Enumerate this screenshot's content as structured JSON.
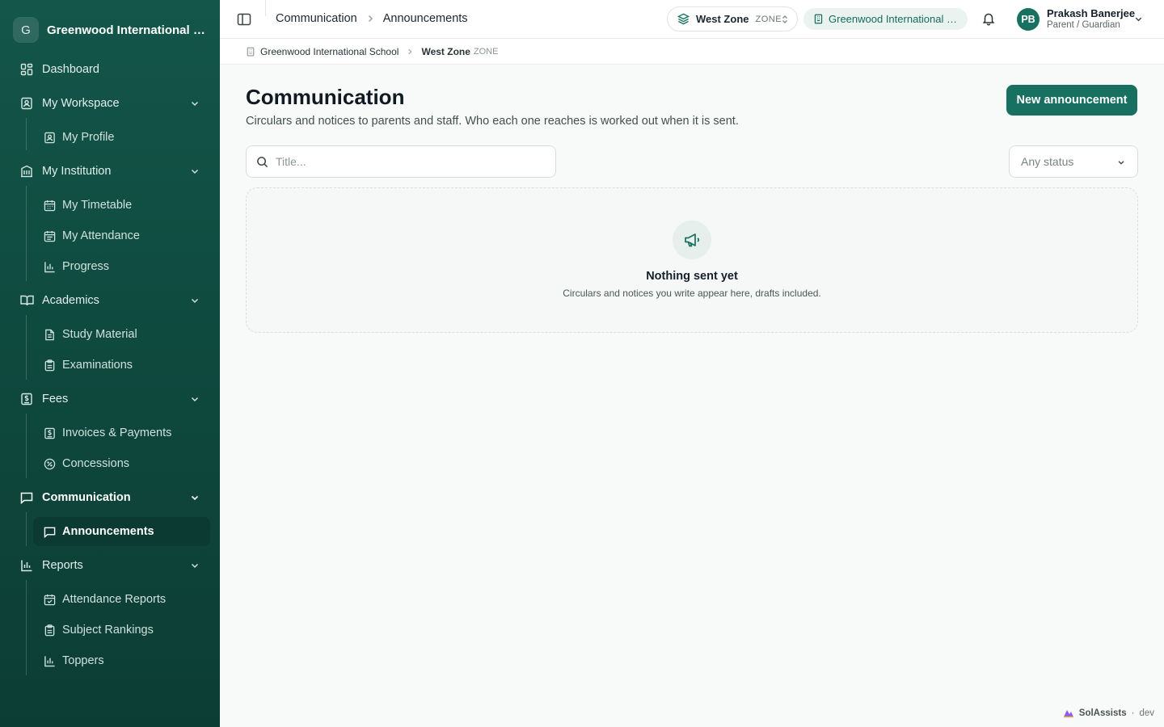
{
  "brand": {
    "badge": "G",
    "name": "Greenwood International School"
  },
  "sidebar": {
    "dashboard": "Dashboard",
    "groups": [
      {
        "label": "My Workspace",
        "items": [
          "My Profile"
        ]
      },
      {
        "label": "My Institution",
        "items": [
          "My Timetable",
          "My Attendance",
          "Progress"
        ]
      },
      {
        "label": "Academics",
        "items": [
          "Study Material",
          "Examinations"
        ]
      },
      {
        "label": "Fees",
        "items": [
          "Invoices & Payments",
          "Concessions"
        ]
      },
      {
        "label": "Communication",
        "items": [
          "Announcements"
        ]
      },
      {
        "label": "Reports",
        "items": [
          "Attendance Reports",
          "Subject Rankings",
          "Toppers"
        ]
      }
    ]
  },
  "topbar": {
    "crumbs": [
      "Communication",
      "Announcements"
    ],
    "zone_name": "West Zone",
    "zone_tag": "ZONE",
    "school": "Greenwood International School",
    "user": {
      "initials": "PB",
      "name": "Prakash Banerjee",
      "role": "Parent / Guardian"
    }
  },
  "subcrumb": {
    "school": "Greenwood International School",
    "zone_name": "West Zone",
    "zone_tag": "ZONE"
  },
  "main": {
    "title": "Communication",
    "description": "Circulars and notices to parents and staff. Who each one reaches is worked out when it is sent.",
    "new_button": "New announcement",
    "search_placeholder": "Title...",
    "status_selected": "Any status",
    "empty_title": "Nothing sent yet",
    "empty_sub": "Circulars and notices you write appear here, drafts included."
  },
  "footer": {
    "name": "SolAssists",
    "env": "dev"
  },
  "colors": {
    "primary": "#177060",
    "sidebar": "#0f4a3f",
    "active_item": "#0b3a32"
  }
}
